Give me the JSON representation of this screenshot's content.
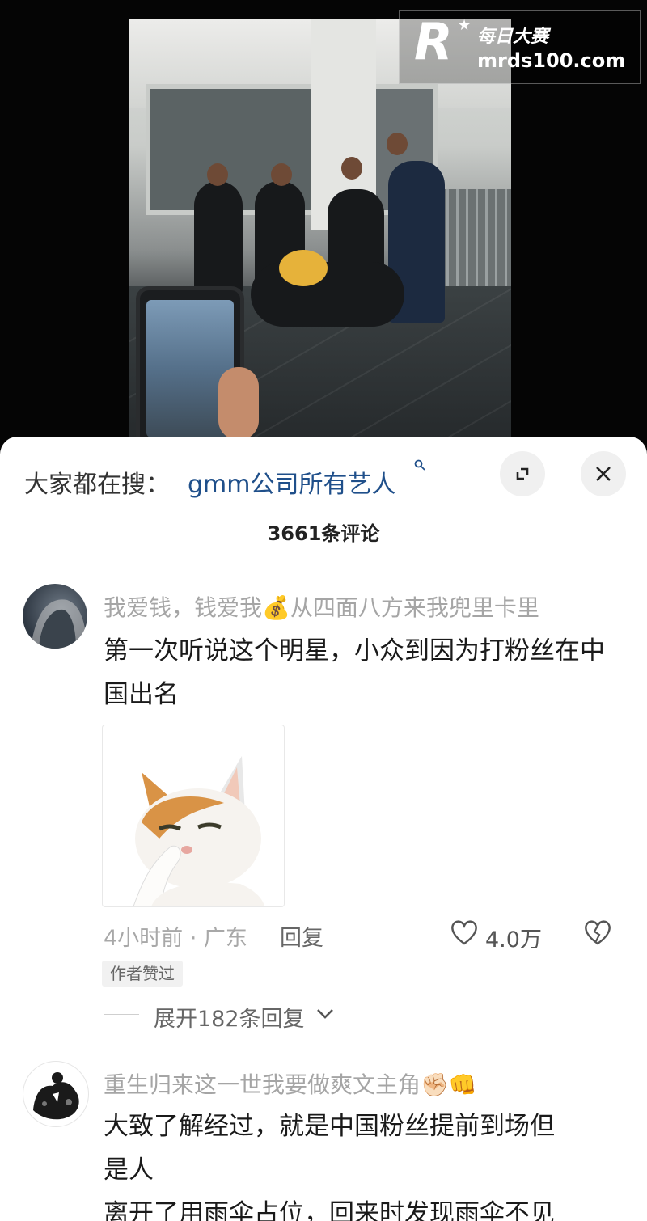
{
  "watermark": {
    "logo_letter": "R",
    "brand_cn": "每日大赛",
    "url": "mrds100.com"
  },
  "sheet": {
    "search_prefix": "大家都在搜：",
    "search_term": "gmm公司所有艺人",
    "comment_count": "3661条评论"
  },
  "comments": [
    {
      "username": "我爱钱，钱爱我💰从四面八方来我兜里卡里",
      "text": "第一次听说这个明星，小众到因为打粉丝在中国出名",
      "time_location": "4小时前 · 广东",
      "reply_label": "回复",
      "likes": "4.0万",
      "badge": "作者赞过",
      "expand_replies": "展开182条回复"
    },
    {
      "username": "重生归来这一世我要做爽文主角✊🏻👊",
      "text_line1": "大致了解经过，就是中国粉丝提前到场但",
      "text_line2": "是人",
      "text_line3": "离开了用雨伞占位，回来时发现雨伞不见"
    }
  ],
  "icons": {
    "expand": "expand-icon",
    "close": "close-icon",
    "search": "search-icon",
    "like": "heart-icon",
    "dislike": "broken-heart-icon",
    "chevron": "chevron-down-icon"
  },
  "colors": {
    "search_link": "#1f4f8a",
    "username": "#a5a5a5",
    "meta": "#a8a8a8"
  }
}
